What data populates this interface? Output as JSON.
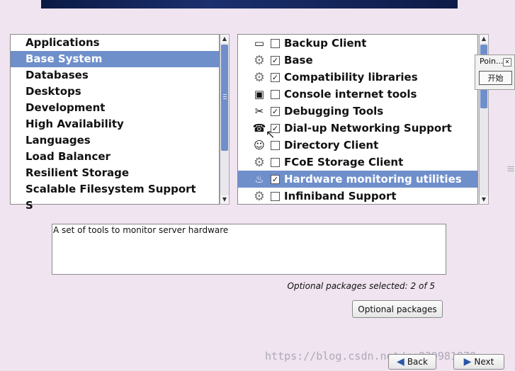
{
  "categories": {
    "items": [
      {
        "label": "Applications"
      },
      {
        "label": "Base System",
        "selected": true
      },
      {
        "label": "Databases"
      },
      {
        "label": "Desktops"
      },
      {
        "label": "Development"
      },
      {
        "label": "High Availability"
      },
      {
        "label": "Languages"
      },
      {
        "label": "Load Balancer"
      },
      {
        "label": "Resilient Storage"
      },
      {
        "label": "Scalable Filesystem Support"
      },
      {
        "label": "S"
      }
    ]
  },
  "packages": {
    "items": [
      {
        "label": "Backup Client",
        "checked": false,
        "icon": "backup-client-icon"
      },
      {
        "label": "Base",
        "checked": true,
        "icon": "gear-icon"
      },
      {
        "label": "Compatibility libraries",
        "checked": true,
        "icon": "gear-icon"
      },
      {
        "label": "Console internet tools",
        "checked": false,
        "icon": "terminal-icon"
      },
      {
        "label": "Debugging Tools",
        "checked": true,
        "icon": "tools-icon"
      },
      {
        "label": "Dial-up Networking Support",
        "checked": true,
        "icon": "phone-icon"
      },
      {
        "label": "Directory Client",
        "checked": false,
        "icon": "users-icon"
      },
      {
        "label": "FCoE Storage Client",
        "checked": false,
        "icon": "gear-icon"
      },
      {
        "label": "Hardware monitoring utilities",
        "checked": true,
        "icon": "hardware-monitor-icon",
        "selected": true
      },
      {
        "label": "Infiniband Support",
        "checked": false,
        "icon": "gear-icon"
      }
    ]
  },
  "description": "A set of tools to monitor server hardware",
  "optional_selected": "Optional packages selected: 2 of 5",
  "buttons": {
    "optional": "Optional packages",
    "back": "Back",
    "next": "Next"
  },
  "popup": {
    "title": "Poin...",
    "button": "开始"
  },
  "watermark": "https://blog.csdn.net/qq839981870",
  "colors": {
    "selection": "#6f8fcb",
    "background": "#efe4ef"
  }
}
